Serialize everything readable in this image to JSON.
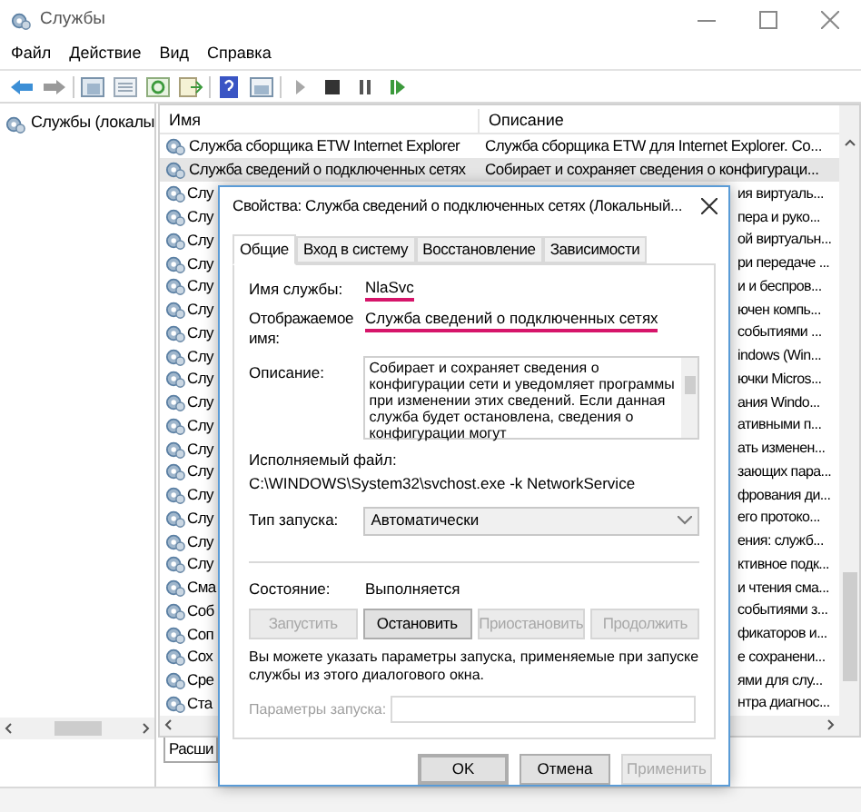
{
  "window": {
    "title": "Службы"
  },
  "menu": [
    "Файл",
    "Действие",
    "Вид",
    "Справка"
  ],
  "tree": {
    "item": "Службы (локалы"
  },
  "list": {
    "columns": [
      "Имя",
      "Описание"
    ],
    "rows": [
      {
        "kind": "full",
        "name": "Служба сборщика ETW Internet Explorer",
        "description": "Служба сборщика ETW для Internet Explorer. Co...",
        "selected": false
      },
      {
        "kind": "full",
        "name": "Служба сведений о подключенных сетях",
        "description": "Собирает и сохраняет сведения о конфигураци...",
        "selected": true
      },
      {
        "kind": "covered",
        "name": "Слу",
        "description": "ия виртуаль..."
      },
      {
        "kind": "covered",
        "name": "Слу",
        "description": "пера и руко..."
      },
      {
        "kind": "covered",
        "name": "Слу",
        "description": "ой виртуальн..."
      },
      {
        "kind": "covered",
        "name": "Слу",
        "description": "ри передаче ..."
      },
      {
        "kind": "covered",
        "name": "Слу",
        "description": "и и беспров..."
      },
      {
        "kind": "covered",
        "name": "Слу",
        "description": "ючен компь..."
      },
      {
        "kind": "covered",
        "name": "Слу",
        "description": "событиями ..."
      },
      {
        "kind": "covered",
        "name": "Слу",
        "description": "indows (Win..."
      },
      {
        "kind": "covered",
        "name": "Слу",
        "description": "ючки Micros..."
      },
      {
        "kind": "covered",
        "name": "Слу",
        "description": "ания Windo..."
      },
      {
        "kind": "covered",
        "name": "Слу",
        "description": "ативными п..."
      },
      {
        "kind": "covered",
        "name": "Слу",
        "description": "ать изменен..."
      },
      {
        "kind": "covered",
        "name": "Слу",
        "description": "зающих пара..."
      },
      {
        "kind": "covered",
        "name": "Слу",
        "description": "фрования ди..."
      },
      {
        "kind": "covered",
        "name": "Слу",
        "description": "его протоко..."
      },
      {
        "kind": "covered",
        "name": "Слу",
        "description": "ения: служб..."
      },
      {
        "kind": "covered",
        "name": "Слу",
        "description": "ктивное подк..."
      },
      {
        "kind": "covered",
        "name": "Сма",
        "description": "и чтения сма..."
      },
      {
        "kind": "covered",
        "name": "Соб",
        "description": "событиями з..."
      },
      {
        "kind": "covered",
        "name": "Соп",
        "description": "фикаторов и..."
      },
      {
        "kind": "covered",
        "name": "Сох",
        "description": "е сохранени..."
      },
      {
        "kind": "covered",
        "name": "Сре",
        "description": "ями для слу..."
      },
      {
        "kind": "covered",
        "name": "Ста",
        "description": "нтра диагнос..."
      }
    ],
    "bottom_tab": "Расши"
  },
  "dialog": {
    "title": "Свойства: Служба сведений о подключенных сетях (Локальный...",
    "tabs": [
      {
        "label": "Общие",
        "selected": true
      },
      {
        "label": "Вход в систему",
        "selected": false
      },
      {
        "label": "Восстановление",
        "selected": false
      },
      {
        "label": "Зависимости",
        "selected": false
      }
    ],
    "service_name": {
      "label": "Имя службы:",
      "value": "NlaSvc",
      "underlined": true
    },
    "display_name": {
      "label": "Отображаемое имя:",
      "value": "Служба сведений о подключенных сетях",
      "underlined": true
    },
    "description": {
      "label": "Описание:",
      "value": "Собирает и сохраняет сведения о конфигурации сети и уведомляет программы при изменении этих сведений. Если данная служба будет остановлена, сведения о конфигурации могут"
    },
    "executable": {
      "label": "Исполняемый файл:",
      "value": "C:\\WINDOWS\\System32\\svchost.exe -k NetworkService"
    },
    "startup_type": {
      "label": "Тип запуска:",
      "value": "Автоматически"
    },
    "status": {
      "label": "Состояние:",
      "value": "Выполняется"
    },
    "service_buttons": [
      {
        "label": "Запустить",
        "disabled": true
      },
      {
        "label": "Остановить",
        "disabled": false
      },
      {
        "label": "Приостановить",
        "disabled": true
      },
      {
        "label": "Продолжить",
        "disabled": true
      }
    ],
    "hint": "Вы можете указать параметры запуска, применяемые при запуске службы из этого диалогового окна.",
    "parameters": {
      "label": "Параметры запуска:",
      "disabled": true
    },
    "buttons": [
      {
        "label": "OK",
        "disabled": false,
        "default": true
      },
      {
        "label": "Отмена",
        "disabled": false,
        "default": false
      },
      {
        "label": "Применить",
        "disabled": true,
        "default": false
      }
    ]
  }
}
